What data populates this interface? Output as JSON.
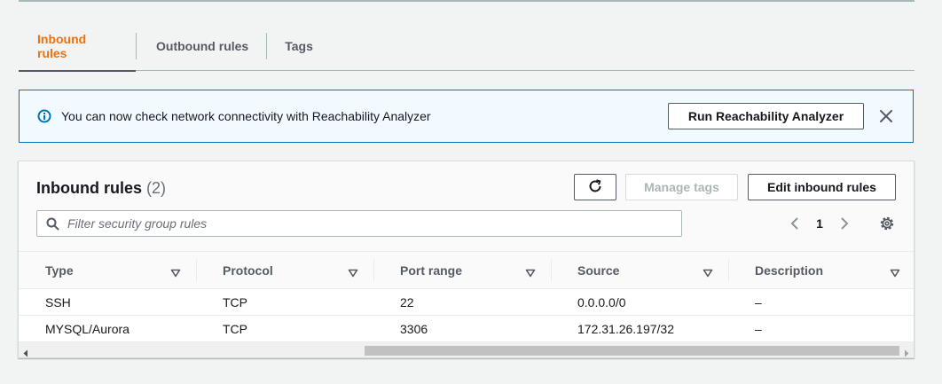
{
  "tabs": [
    {
      "label": "Inbound rules",
      "active": true
    },
    {
      "label": "Outbound rules",
      "active": false
    },
    {
      "label": "Tags",
      "active": false
    }
  ],
  "flash": {
    "message": "You can now check network connectivity with Reachability Analyzer",
    "button_label": "Run Reachability Analyzer",
    "icon": "info-icon",
    "close_icon": "close-icon"
  },
  "panel": {
    "title": "Inbound rules",
    "count": "(2)",
    "refresh_icon": "refresh-icon",
    "manage_tags_label": "Manage tags",
    "edit_label": "Edit inbound rules"
  },
  "search": {
    "placeholder": "Filter security group rules",
    "value": ""
  },
  "pagination": {
    "current_page": "1"
  },
  "table": {
    "columns": [
      "Type",
      "Protocol",
      "Port range",
      "Source",
      "Description"
    ],
    "rows": [
      [
        "SSH",
        "TCP",
        "22",
        "0.0.0.0/0",
        "–"
      ],
      [
        "MYSQL/Aurora",
        "TCP",
        "3306",
        "172.31.26.197/32",
        "–"
      ]
    ]
  },
  "colors": {
    "accent": "#ec7211",
    "info_border": "#0073bb",
    "info_bg": "#f1faff"
  }
}
